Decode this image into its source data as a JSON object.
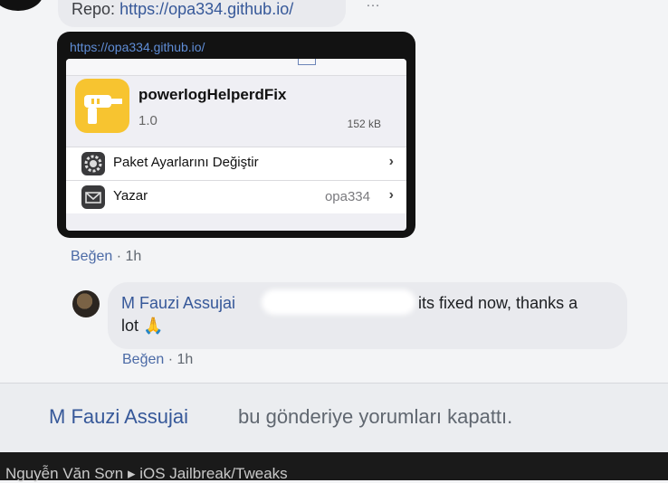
{
  "post": {
    "repo_label": "Repo:",
    "repo_url": "https://opa334.github.io/"
  },
  "embedded": {
    "url": "https://opa334.github.io/",
    "package": {
      "name": "powerlogHelperdFix",
      "version": "1.0",
      "size": "152 kB",
      "icon": "drill-icon"
    },
    "rows": [
      {
        "label": "Paket Ayarlarını Değiştir",
        "value": "",
        "icon": "gear-icon"
      },
      {
        "label": "Yazar",
        "value": "opa334",
        "icon": "mail-icon"
      }
    ]
  },
  "comment1_meta": {
    "like": "Beğen",
    "sep": " · ",
    "time": "1h"
  },
  "comment2": {
    "author": "M Fauzi Assujai",
    "text_line1": "its fixed now, thanks a",
    "text_line2": "lot 🙏",
    "like": "Beğen",
    "sep": " · ",
    "time": "1h"
  },
  "closed_notice": {
    "name": "M Fauzi Assujai",
    "text": "bu gönderiye yorumları kapattı."
  },
  "bottom_bar": {
    "text": "Nguyễn Văn Sơn  ▸  iOS Jailbreak/Tweaks"
  }
}
